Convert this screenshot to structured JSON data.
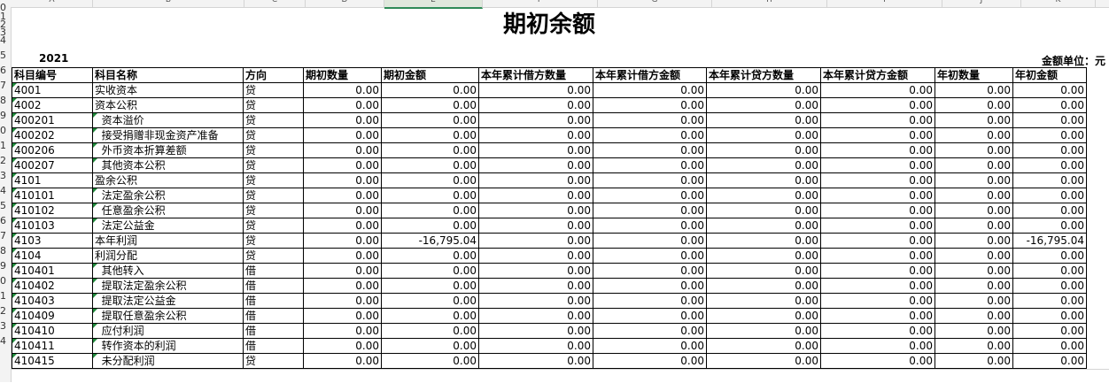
{
  "sheet": {
    "title": "期初余额",
    "year": "2021",
    "unit_label": "金额单位：元",
    "column_letters": [
      "A",
      "B",
      "C",
      "D",
      "E",
      "F",
      "G",
      "H",
      "I",
      "J",
      "K"
    ],
    "row_numbers": [
      "0",
      "1",
      "2",
      "3",
      "4",
      "5",
      "6",
      "7",
      "8",
      "9",
      "0",
      "1",
      "2",
      "3",
      "4",
      "5",
      "6",
      "7",
      "8",
      "9",
      "0",
      "1",
      "2",
      "3",
      "4"
    ],
    "headers": [
      "科目编号",
      "科目名称",
      "方向",
      "期初数量",
      "期初金额",
      "本年累计借方数量",
      "本年累计借方金额",
      "本年累计贷方数量",
      "本年累计贷方金额",
      "年初数量",
      "年初金额"
    ],
    "rows": [
      {
        "code": "4001",
        "name": "实收资本",
        "dir": "贷",
        "v": [
          "0.00",
          "0.00",
          "0.00",
          "0.00",
          "0.00",
          "0.00",
          "0.00",
          "0.00"
        ]
      },
      {
        "code": "4002",
        "name": "资本公积",
        "dir": "贷",
        "v": [
          "0.00",
          "0.00",
          "0.00",
          "0.00",
          "0.00",
          "0.00",
          "0.00",
          "0.00"
        ]
      },
      {
        "code": "400201",
        "name": "  资本溢价",
        "dir": "贷",
        "v": [
          "0.00",
          "0.00",
          "0.00",
          "0.00",
          "0.00",
          "0.00",
          "0.00",
          "0.00"
        ]
      },
      {
        "code": "400202",
        "name": "  接受捐赠非现金资产准备",
        "dir": "贷",
        "v": [
          "0.00",
          "0.00",
          "0.00",
          "0.00",
          "0.00",
          "0.00",
          "0.00",
          "0.00"
        ]
      },
      {
        "code": "400206",
        "name": "  外币资本折算差额",
        "dir": "贷",
        "v": [
          "0.00",
          "0.00",
          "0.00",
          "0.00",
          "0.00",
          "0.00",
          "0.00",
          "0.00"
        ]
      },
      {
        "code": "400207",
        "name": "  其他资本公积",
        "dir": "贷",
        "v": [
          "0.00",
          "0.00",
          "0.00",
          "0.00",
          "0.00",
          "0.00",
          "0.00",
          "0.00"
        ]
      },
      {
        "code": "4101",
        "name": "盈余公积",
        "dir": "贷",
        "v": [
          "0.00",
          "0.00",
          "0.00",
          "0.00",
          "0.00",
          "0.00",
          "0.00",
          "0.00"
        ]
      },
      {
        "code": "410101",
        "name": "  法定盈余公积",
        "dir": "贷",
        "v": [
          "0.00",
          "0.00",
          "0.00",
          "0.00",
          "0.00",
          "0.00",
          "0.00",
          "0.00"
        ]
      },
      {
        "code": "410102",
        "name": "  任意盈余公积",
        "dir": "贷",
        "v": [
          "0.00",
          "0.00",
          "0.00",
          "0.00",
          "0.00",
          "0.00",
          "0.00",
          "0.00"
        ]
      },
      {
        "code": "410103",
        "name": "  法定公益金",
        "dir": "贷",
        "v": [
          "0.00",
          "0.00",
          "0.00",
          "0.00",
          "0.00",
          "0.00",
          "0.00",
          "0.00"
        ]
      },
      {
        "code": "4103",
        "name": "本年利润",
        "dir": "贷",
        "v": [
          "0.00",
          "-16,795.04",
          "0.00",
          "0.00",
          "0.00",
          "0.00",
          "0.00",
          "-16,795.04"
        ]
      },
      {
        "code": "4104",
        "name": "利润分配",
        "dir": "贷",
        "v": [
          "0.00",
          "0.00",
          "0.00",
          "0.00",
          "0.00",
          "0.00",
          "0.00",
          "0.00"
        ]
      },
      {
        "code": "410401",
        "name": "  其他转入",
        "dir": "借",
        "v": [
          "0.00",
          "0.00",
          "0.00",
          "0.00",
          "0.00",
          "0.00",
          "0.00",
          "0.00"
        ]
      },
      {
        "code": "410402",
        "name": "  提取法定盈余公积",
        "dir": "借",
        "v": [
          "0.00",
          "0.00",
          "0.00",
          "0.00",
          "0.00",
          "0.00",
          "0.00",
          "0.00"
        ]
      },
      {
        "code": "410403",
        "name": "  提取法定公益金",
        "dir": "借",
        "v": [
          "0.00",
          "0.00",
          "0.00",
          "0.00",
          "0.00",
          "0.00",
          "0.00",
          "0.00"
        ]
      },
      {
        "code": "410409",
        "name": "  提取任意盈余公积",
        "dir": "借",
        "v": [
          "0.00",
          "0.00",
          "0.00",
          "0.00",
          "0.00",
          "0.00",
          "0.00",
          "0.00"
        ]
      },
      {
        "code": "410410",
        "name": "  应付利润",
        "dir": "借",
        "v": [
          "0.00",
          "0.00",
          "0.00",
          "0.00",
          "0.00",
          "0.00",
          "0.00",
          "0.00"
        ]
      },
      {
        "code": "410411",
        "name": "  转作资本的利润",
        "dir": "借",
        "v": [
          "0.00",
          "0.00",
          "0.00",
          "0.00",
          "0.00",
          "0.00",
          "0.00",
          "0.00"
        ]
      },
      {
        "code": "410415",
        "name": "  未分配利润",
        "dir": "贷",
        "v": [
          "0.00",
          "0.00",
          "0.00",
          "0.00",
          "0.00",
          "0.00",
          "0.00",
          "0.00"
        ]
      }
    ],
    "selected_column": "E",
    "marker_color": "#1f8a3a"
  }
}
